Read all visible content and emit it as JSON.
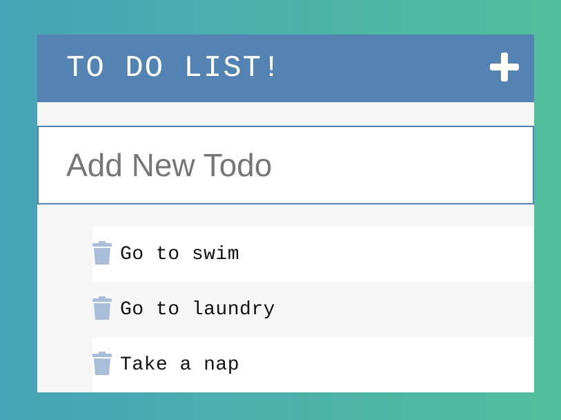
{
  "header": {
    "title": "TO DO LIST!",
    "add_icon": "plus-icon"
  },
  "input": {
    "placeholder": "Add New Todo",
    "value": ""
  },
  "todos": [
    {
      "text": "Go to swim",
      "icon": "trash-icon"
    },
    {
      "text": "Go to laundry",
      "icon": "trash-icon"
    },
    {
      "text": "Take a nap",
      "icon": "trash-icon"
    }
  ],
  "colors": {
    "header_bg": "#5283b3",
    "trash_icon": "#a9bfd9",
    "gradient_start": "#46a3b8",
    "gradient_end": "#52bf9c"
  }
}
